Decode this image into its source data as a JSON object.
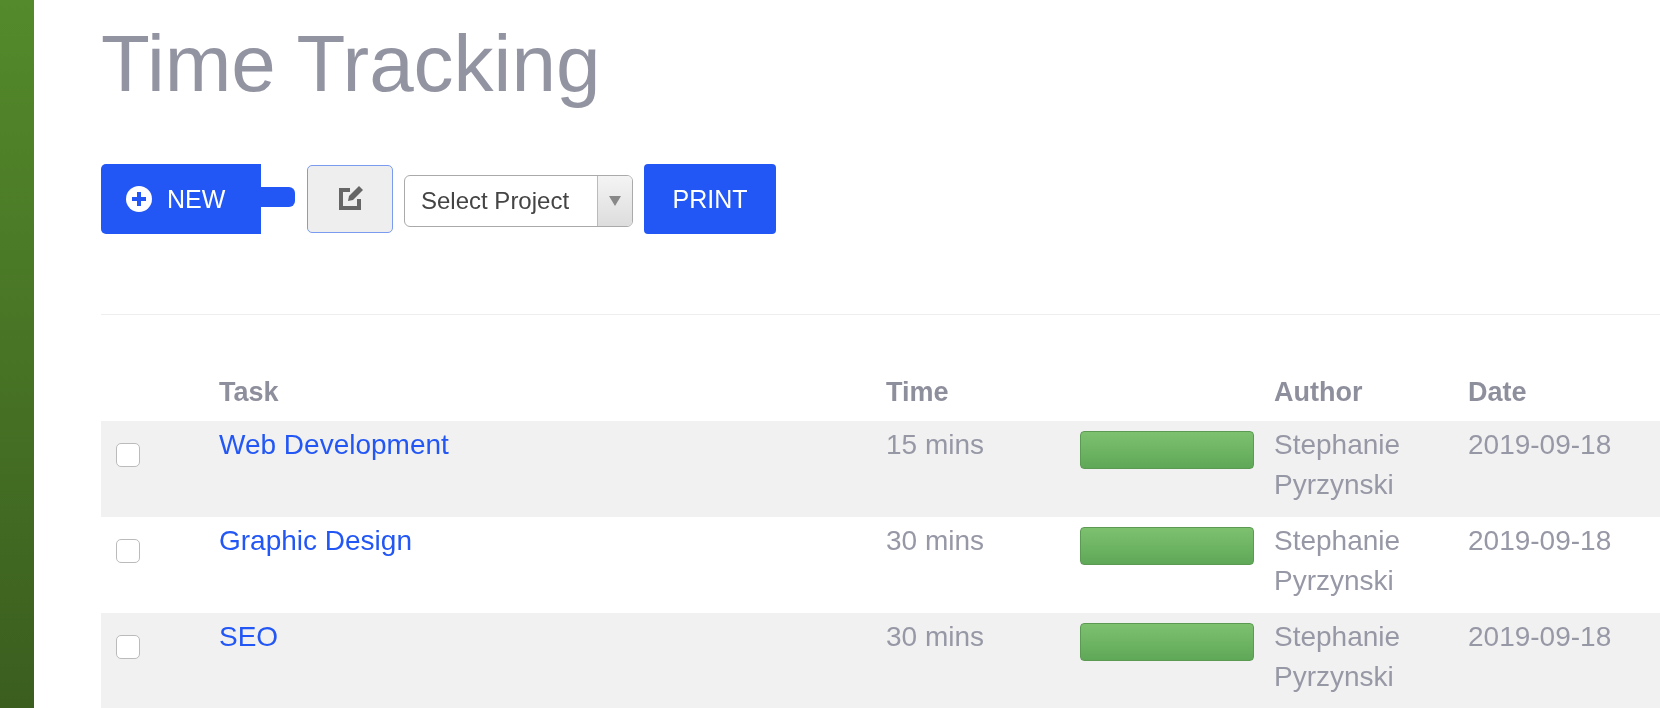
{
  "title": "Time Tracking",
  "toolbar": {
    "new_button": "NEW",
    "project_select": {
      "value": "Select Project"
    },
    "print_button": "PRINT"
  },
  "table": {
    "columns": [
      "Task",
      "Time",
      "Author",
      "Date"
    ],
    "rows": [
      {
        "checked": false,
        "task": "Web Development",
        "time": "15 mins",
        "level": 1,
        "author": "Stephanie Pyrzynski",
        "date": "2019-09-18"
      },
      {
        "checked": false,
        "task": "Graphic Design",
        "time": "30 mins",
        "level": 1,
        "author": "Stephanie Pyrzynski",
        "date": "2019-09-18"
      },
      {
        "checked": false,
        "task": "SEO",
        "time": "30 mins",
        "level": 1,
        "author": "Stephanie Pyrzynski",
        "date": "2019-09-18"
      }
    ]
  }
}
